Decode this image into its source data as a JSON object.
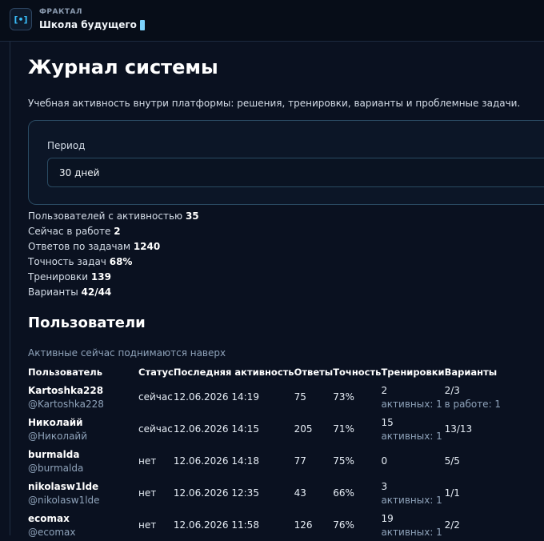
{
  "brand": {
    "logo_text": "[•]",
    "small_title": "ФРАКТАЛ",
    "name": "Школа будущего"
  },
  "page": {
    "title": "Журнал системы",
    "subtitle": "Учебная активность внутри платформы: решения, тренировки, варианты и проблемные задачи."
  },
  "period": {
    "label": "Период",
    "value": "30 дней"
  },
  "stats": [
    {
      "label": "Пользователей с активностью",
      "value": "35"
    },
    {
      "label": "Сейчас в работе",
      "value": "2"
    },
    {
      "label": "Ответов по задачам",
      "value": "1240"
    },
    {
      "label": "Точность задач",
      "value": "68%"
    },
    {
      "label": "Тренировки",
      "value": "139"
    },
    {
      "label": "Варианты",
      "value": "42/44"
    }
  ],
  "users_section": {
    "title": "Пользователи",
    "hint": "Активные сейчас поднимаются наверх",
    "columns": [
      "Пользователь",
      "Статус",
      "Последняя активность",
      "Ответы",
      "Точность",
      "Тренировки",
      "Варианты"
    ],
    "rows": [
      {
        "name": "Kartoshka228",
        "handle": "@Kartoshka228",
        "status": "сейчас",
        "last": "12.06.2026 14:19",
        "answers": "75",
        "accuracy": "73%",
        "trainings": "2",
        "trainings_sub": "активных: 1",
        "variants": "2/3",
        "variants_sub": "в работе: 1"
      },
      {
        "name": "Николайй",
        "handle": "@Николайй",
        "status": "сейчас",
        "last": "12.06.2026 14:15",
        "answers": "205",
        "accuracy": "71%",
        "trainings": "15",
        "trainings_sub": "активных: 1",
        "variants": "13/13",
        "variants_sub": ""
      },
      {
        "name": "burmalda",
        "handle": "@burmalda",
        "status": "нет",
        "last": "12.06.2026 14:18",
        "answers": "77",
        "accuracy": "75%",
        "trainings": "0",
        "trainings_sub": "",
        "variants": "5/5",
        "variants_sub": ""
      },
      {
        "name": "nikolasw1lde",
        "handle": "@nikolasw1lde",
        "status": "нет",
        "last": "12.06.2026 12:35",
        "answers": "43",
        "accuracy": "66%",
        "trainings": "3",
        "trainings_sub": "активных: 1",
        "variants": "1/1",
        "variants_sub": ""
      },
      {
        "name": "ecomax",
        "handle": "@ecomax",
        "status": "нет",
        "last": "12.06.2026 11:58",
        "answers": "126",
        "accuracy": "76%",
        "trainings": "19",
        "trainings_sub": "активных: 1",
        "variants": "2/2",
        "variants_sub": ""
      }
    ]
  }
}
